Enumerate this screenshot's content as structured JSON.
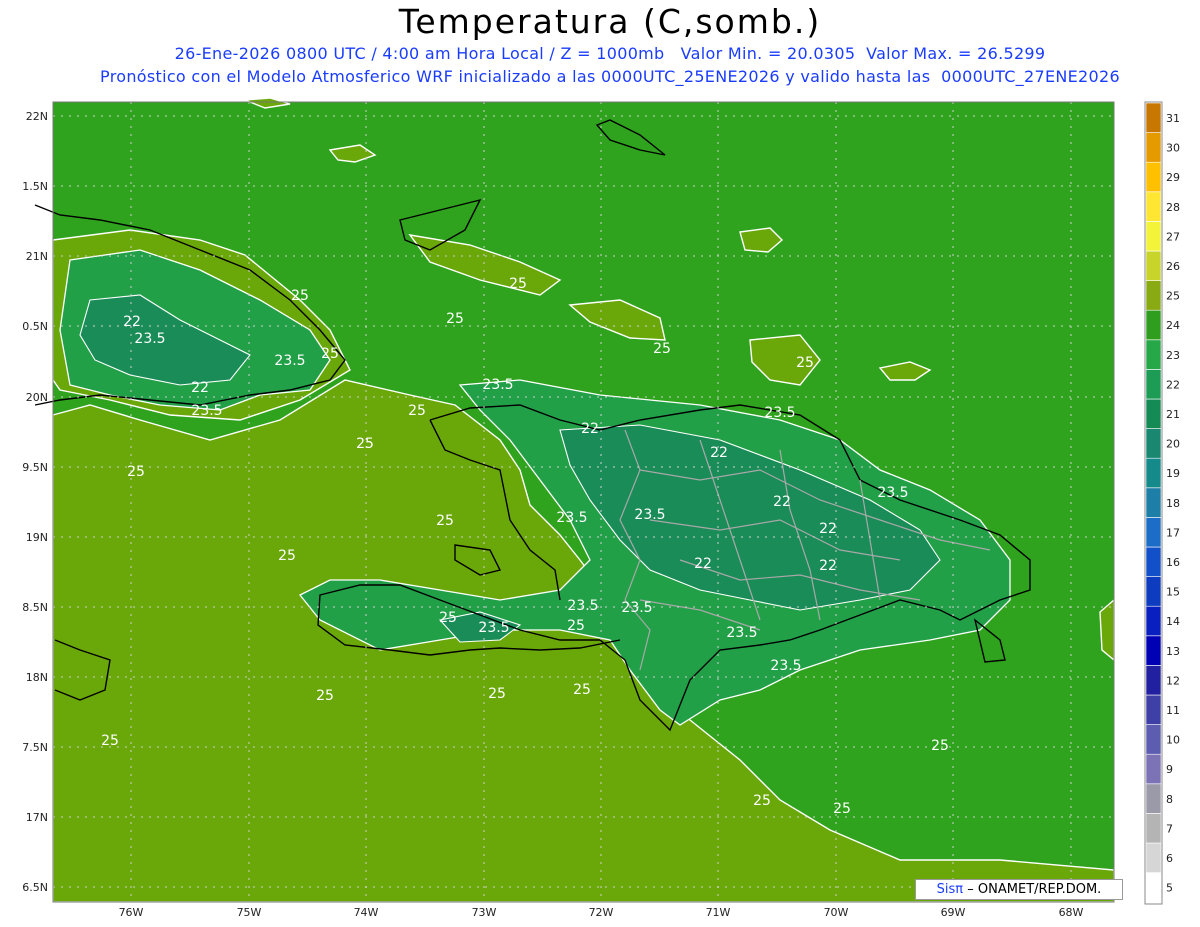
{
  "header": {
    "title": "Temperatura (C,somb.)",
    "line1": "26-Ene-2026 0800 UTC / 4:00 am Hora Local / Z = 1000mb   Valor Min. = 20.0305  Valor Max. = 26.5299",
    "line2": "Pronóstico con el Modelo Atmosferico WRF inicializado a las 0000UTC_25ENE2026 y valido hasta las  0000UTC_27ENE2026"
  },
  "map": {
    "lat_labels": [
      "22N",
      "1.5N",
      "21N",
      "0.5N",
      "20N",
      "9.5N",
      "19N",
      "8.5N",
      "18N",
      "7.5N",
      "17N",
      "6.5N"
    ],
    "lon_labels": [
      "76W",
      "75W",
      "74W",
      "73W",
      "72W",
      "71W",
      "70W",
      "69W",
      "68W"
    ],
    "contour_labels": [
      "25",
      "25",
      "25",
      "25",
      "25",
      "25",
      "25",
      "25",
      "25",
      "25",
      "25",
      "25",
      "25",
      "25",
      "25",
      "25",
      "25",
      "25",
      "25",
      "25",
      "23.5",
      "23.5",
      "23.5",
      "23.5",
      "23.5",
      "23.5",
      "23.5",
      "23.5",
      "23.5",
      "23.5",
      "23.5",
      "23.5",
      "23.5",
      "22",
      "22",
      "22",
      "22",
      "22",
      "22",
      "22",
      "22"
    ]
  },
  "colorbar": {
    "labels": [
      "31",
      "30",
      "29",
      "28",
      "27",
      "26",
      "25",
      "24",
      "23",
      "22",
      "21",
      "20",
      "19",
      "18",
      "17",
      "16",
      "15",
      "14",
      "13",
      "12",
      "11",
      "10",
      "9",
      "8",
      "7",
      "6",
      "5"
    ],
    "colors": [
      "#c87800",
      "#e59a00",
      "#ffc000",
      "#ffe633",
      "#f3f33a",
      "#c8d42a",
      "#8aaa14",
      "#2f9e1e",
      "#27a848",
      "#1d9c55",
      "#148a55",
      "#1a8870",
      "#148a8a",
      "#1d7ea8",
      "#1c6dc8",
      "#1150c8",
      "#0d3cc0",
      "#0a1fc0",
      "#0000b4",
      "#2020a0",
      "#3f3fa8",
      "#5c5cb0",
      "#7c72b6",
      "#9a9aa8",
      "#b4b4b4",
      "#d6d6d6",
      "#ffffff"
    ]
  },
  "credit": {
    "brand": "Sisπ",
    "text": "– ONAMET/REP.DOM."
  }
}
